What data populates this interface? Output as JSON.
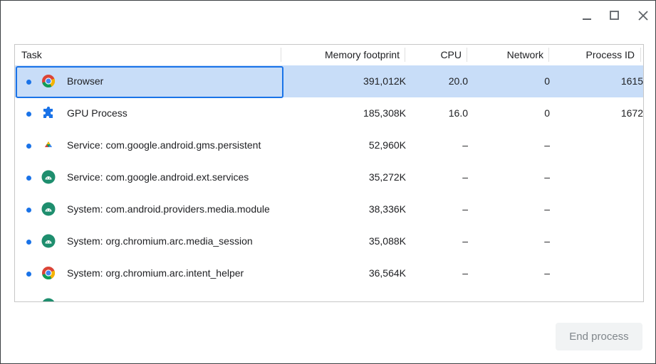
{
  "window": {
    "controls": {
      "minimize_icon": "minimize-icon",
      "maximize_icon": "maximize-icon",
      "close_icon": "close-icon"
    }
  },
  "table": {
    "headers": {
      "task": "Task",
      "memory": "Memory footprint",
      "cpu": "CPU",
      "network": "Network",
      "pid": "Process ID"
    },
    "rows": [
      {
        "icon": "chrome-icon",
        "task": "Browser",
        "memory": "391,012K",
        "cpu": "20.0",
        "network": "0",
        "pid": "1615"
      },
      {
        "icon": "puzzle-extension-icon",
        "task": "GPU Process",
        "memory": "185,308K",
        "cpu": "16.0",
        "network": "0",
        "pid": "1672"
      },
      {
        "icon": "play-services-icon",
        "task": "Service: com.google.android.gms.persistent",
        "memory": "52,960K",
        "cpu": "–",
        "network": "–",
        "pid": ""
      },
      {
        "icon": "android-icon",
        "task": "Service: com.google.android.ext.services",
        "memory": "35,272K",
        "cpu": "–",
        "network": "–",
        "pid": ""
      },
      {
        "icon": "android-icon",
        "task": "System: com.android.providers.media.module",
        "memory": "38,336K",
        "cpu": "–",
        "network": "–",
        "pid": ""
      },
      {
        "icon": "android-icon",
        "task": "System: org.chromium.arc.media_session",
        "memory": "35,088K",
        "cpu": "–",
        "network": "–",
        "pid": ""
      },
      {
        "icon": "chrome-icon",
        "task": "System: org.chromium.arc.intent_helper",
        "memory": "36,564K",
        "cpu": "–",
        "network": "–",
        "pid": ""
      }
    ]
  },
  "footer": {
    "end_process_label": "End process"
  },
  "colors": {
    "accent": "#1a73e8",
    "selected_row": "#c8ddf8",
    "android_green": "#1e8e6e"
  }
}
